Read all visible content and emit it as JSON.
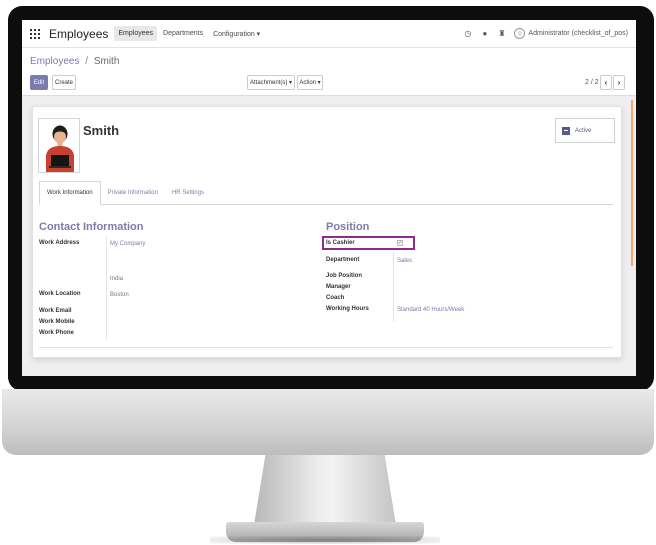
{
  "topbar": {
    "app_name": "Employees",
    "menu": [
      "Employees",
      "Departments",
      "Configuration ▾"
    ],
    "user": "Administrator (checklist_of_pos)",
    "icons": [
      "clock-icon",
      "chat-icon",
      "bug-icon",
      "user-avatar-icon"
    ]
  },
  "breadcrumb": {
    "parent": "Employees",
    "separator": "/",
    "current": "Smith"
  },
  "buttons": {
    "edit": "Edit",
    "create": "Create",
    "attachments": "Attachment(s) ▾",
    "action": "Action ▾",
    "prev": "‹",
    "next": "›"
  },
  "pager": "2 / 2",
  "employee": {
    "name": "Smith",
    "active_label": "Active"
  },
  "tabs": [
    "Work Information",
    "Private Information",
    "HR Settings"
  ],
  "contact": {
    "title": "Contact Information",
    "work_address_label": "Work Address",
    "work_address_company": "My Company",
    "work_address_country": "India",
    "work_location_label": "Work Location",
    "work_location_value": "Boston",
    "work_email_label": "Work Email",
    "work_mobile_label": "Work Mobile",
    "work_phone_label": "Work Phone"
  },
  "position": {
    "title": "Position",
    "is_cashier_label": "Is Cashier",
    "is_cashier_checked": "✓",
    "department_label": "Department",
    "department_value": "Sales",
    "job_position_label": "Job Position",
    "manager_label": "Manager",
    "coach_label": "Coach",
    "working_hours_label": "Working Hours",
    "working_hours_value": "Standard 40 Hours/Week"
  },
  "colors": {
    "accent": "#7c7bad",
    "highlight": "#8e2b8e"
  }
}
